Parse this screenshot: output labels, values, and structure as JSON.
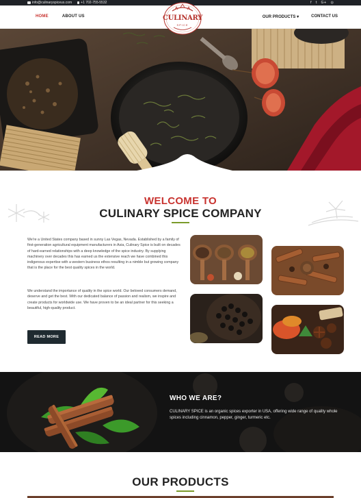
{
  "topbar": {
    "email": "info@culinaryspiceus.com",
    "phone": "+1 702-755-5532",
    "social_icons": [
      "facebook-icon",
      "twitter-icon",
      "google-plus-icon",
      "instagram-icon"
    ]
  },
  "nav": {
    "home": "HOME",
    "about": "ABOUT US",
    "products": "OUR PRODUCTS ▾",
    "contact": "CONTACT US"
  },
  "logo": {
    "name": "CULINARY",
    "sub": "SPICE"
  },
  "welcome": {
    "line1": "WELCOME TO",
    "line2": "CULINARY SPICE COMPANY",
    "paragraph1": "We're a United States company based in sunny Las Vegas, Nevada. Established by a family of first-generation agricultural equipment manufacturers in Asia, Culinary Spice is built on decades of hard-earned relationships with a deep knowledge of the spice industry. By supplying machinery over decades this has earned us the extensive reach we have combined this indigenous expertise with a western business ethos resulting in a nimble but growing company that is the place for the best quality spices in the world.",
    "paragraph2": "We understand the importance of quality in the spice world. Our beloved consumers demand, deserve and get the best. With our dedicated balance of passion and realism, we inspire and create products for worldwide use. We have proven to be an ideal partner for this seeking a beautiful, high-quality product.",
    "read_more": "READ MORE"
  },
  "who": {
    "title": "WHO WE ARE?",
    "text": "CULINARY SPICE is an organic spices exporter in USA, offering wide range of quality whole spices including cinnamon, pepper, ginger, turmeric etc."
  },
  "products": {
    "title": "OUR PRODUCTS"
  },
  "colors": {
    "accent_red": "#c8332f",
    "accent_green": "#7a9a2a",
    "dark": "#1f2a30"
  }
}
